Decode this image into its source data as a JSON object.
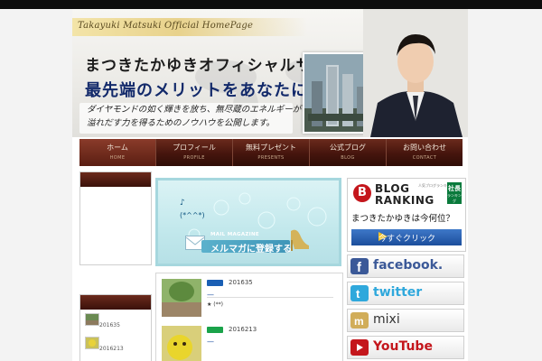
{
  "header": {
    "script_title": "Takayuki Matsuki Official HomePage",
    "title": "まつきたかゆきオフィシャルサイト",
    "subtitle": "最先端のメリットをあなたに",
    "desc_line1": "ダイヤモンドの如く輝きを放ち、無尽蔵のエネルギーが",
    "desc_line2": "溢れだす力を得るためのノウハウを公開します。"
  },
  "nav": {
    "items": [
      {
        "label": "ホーム",
        "en": "HOME"
      },
      {
        "label": "プロフィール",
        "en": "PROFILE"
      },
      {
        "label": "無料プレゼント",
        "en": "PRESENTS"
      },
      {
        "label": "公式ブログ",
        "en": "BLOG"
      },
      {
        "label": "お問い合わせ",
        "en": "CONTACT"
      }
    ]
  },
  "mail": {
    "note1": "♪",
    "note2": "(*^^*)",
    "magazine": "MAIL MAGAZINE",
    "cta": "メルマガに登録する"
  },
  "news": {
    "items": [
      {
        "date": "201635",
        "dash": "—",
        "text": "★ (**)",
        "badge_color": "#1a5fb4"
      },
      {
        "date": "2016213",
        "dash": "—",
        "text": "",
        "badge_color": "#1aa34a"
      }
    ]
  },
  "sidebar_left": {
    "items": [
      {
        "date": "201635"
      },
      {
        "date": "2016213"
      }
    ]
  },
  "blog_ranking": {
    "logo_letter": "B",
    "line1": "BLOG",
    "line2": "RANKING",
    "tag": "人気ブログランキング",
    "ceo_top": "社長",
    "ceo_bottom": "ランキング",
    "question": "まつきたかゆきは今何位？",
    "button": "今すぐクリック"
  },
  "social": {
    "facebook": "facebook.",
    "twitter": "twitter",
    "mixi": "mixi",
    "youtube": "YouTube"
  },
  "colors": {
    "nav_dark": "#45150d",
    "facebook": "#3b5998",
    "twitter": "#2fa8dc",
    "mixi": "#d1ad59",
    "youtube": "#c4161c"
  }
}
